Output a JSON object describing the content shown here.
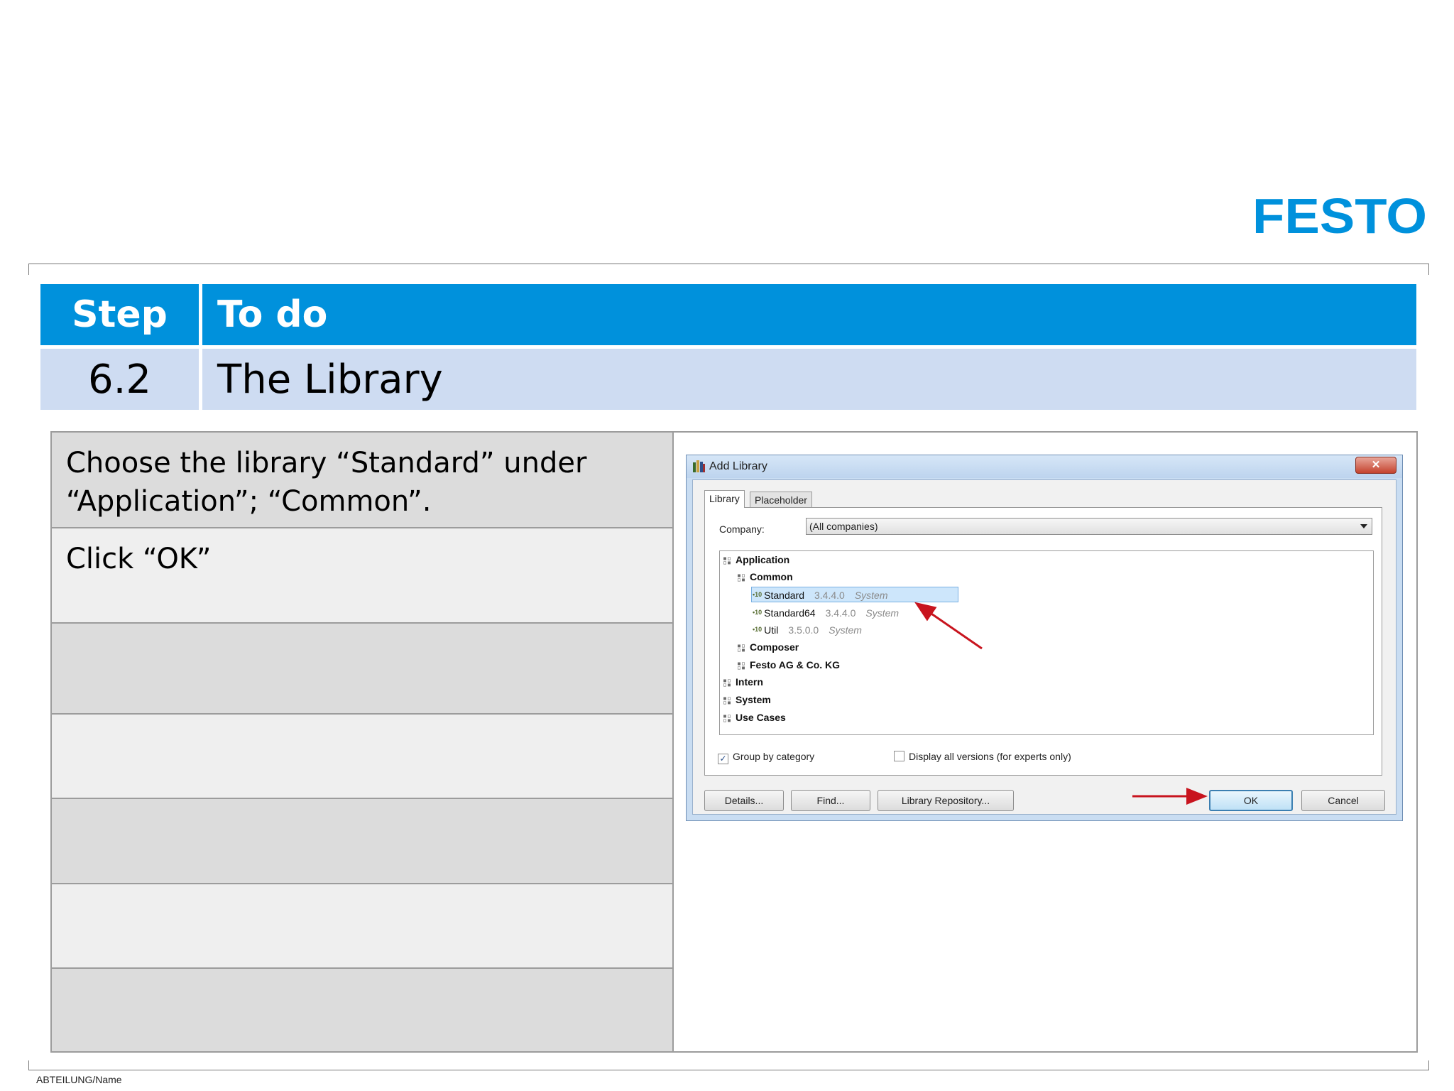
{
  "brand": {
    "logo_text": "FESTO",
    "color": "#0091dc"
  },
  "header": {
    "step_label": "Step",
    "todo_label": "To do",
    "step_value": "6.2",
    "todo_value": "The Library"
  },
  "instructions": [
    "Choose the library “Standard” under “Application”; “Common”.",
    "Click “OK”",
    "",
    "",
    "",
    "",
    ""
  ],
  "dialog": {
    "title": "Add Library",
    "tabs": [
      "Library",
      "Placeholder"
    ],
    "company_label": "Company:",
    "company_value": "(All companies)",
    "tree": {
      "application": "Application",
      "common": "Common",
      "libraries": [
        {
          "name": "Standard",
          "version": "3.4.4.0",
          "category": "System"
        },
        {
          "name": "Standard64",
          "version": "3.4.4.0",
          "category": "System"
        },
        {
          "name": "Util",
          "version": "3.5.0.0",
          "category": "System"
        }
      ],
      "composer": "Composer",
      "festo": "Festo AG & Co. KG",
      "intern": "Intern",
      "system": "System",
      "use_cases": "Use Cases"
    },
    "group_by_category": "Group by category",
    "display_all_versions": "Display all versions (for experts only)",
    "buttons": {
      "details": "Details...",
      "find": "Find...",
      "repository": "Library Repository...",
      "ok": "OK",
      "cancel": "Cancel"
    },
    "close_symbol": "✕"
  },
  "footer": {
    "text": "ABTEILUNG/Name"
  }
}
